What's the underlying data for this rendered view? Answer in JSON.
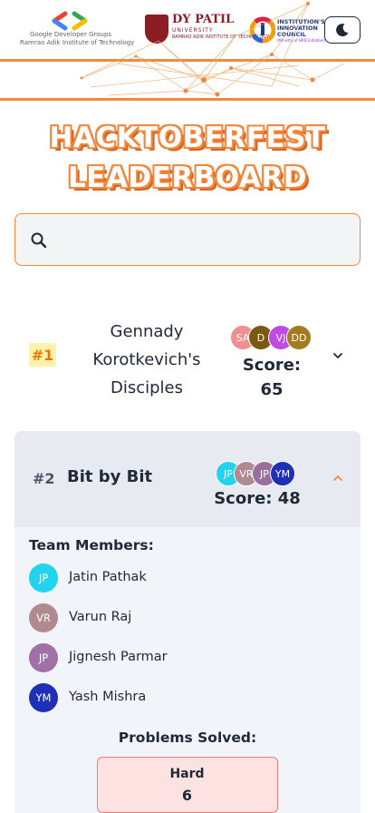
{
  "header": {
    "gdg_logo": {
      "line1": "Google Developer Groups",
      "line2": "Ramrao Adik Institute of Technology"
    },
    "dypatil_logo": {
      "name": "DY PATIL",
      "university": "UNIVERSITY",
      "sub": "RAMRAO ADIK INSTITUTE OF TECHNOLOGY"
    },
    "iic_logo": {
      "line1": "INSTITUTION'S",
      "line2": "INNOVATION",
      "line3": "COUNCIL",
      "line4": "(Ministry of HRD Initiative)"
    },
    "theme_toggle_icon": "moon-icon"
  },
  "title": {
    "line1": "HACKTOBERFEST",
    "line2": "LEADERBOARD"
  },
  "search": {
    "value": "",
    "placeholder": "",
    "icon": "search-icon"
  },
  "teams": [
    {
      "rank": "#1",
      "name_lines": [
        "Gennady",
        "Korotkevich's",
        "Disciples"
      ],
      "avatars": [
        {
          "initials": "SA",
          "color": "#ef8f8f"
        },
        {
          "initials": "D",
          "color": "#7a5a12"
        },
        {
          "initials": "VJ",
          "color": "#c04ae6"
        },
        {
          "initials": "DD",
          "color": "#a17d1f"
        }
      ],
      "score_label": "Score:",
      "score": "65",
      "expanded": false
    },
    {
      "rank": "#2",
      "name": "Bit by Bit",
      "avatars": [
        {
          "initials": "JP",
          "color": "#22d3ee"
        },
        {
          "initials": "VR",
          "color": "#b08a8f"
        },
        {
          "initials": "JP",
          "color": "#9a6f9e"
        },
        {
          "initials": "YM",
          "color": "#1e2fb8"
        }
      ],
      "score_text": "Score: 48",
      "expanded": true,
      "members_title": "Team Members:",
      "members": [
        {
          "initials": "JP",
          "name": "Jatin Pathak",
          "color": "#22d3ee"
        },
        {
          "initials": "VR",
          "name": "Varun Raj",
          "color": "#b08a8f"
        },
        {
          "initials": "JP",
          "name": "Jignesh Parmar",
          "color": "#a070a6"
        },
        {
          "initials": "YM",
          "name": "Yash Mishra",
          "color": "#1e2fb8"
        }
      ],
      "problems_title": "Problems Solved:",
      "problems": [
        {
          "label": "Hard",
          "count": "6"
        }
      ]
    }
  ],
  "colors": {
    "accent": "#f0883e",
    "rank_highlight": "#fef3a8",
    "hard_bg": "#fde2e2"
  }
}
